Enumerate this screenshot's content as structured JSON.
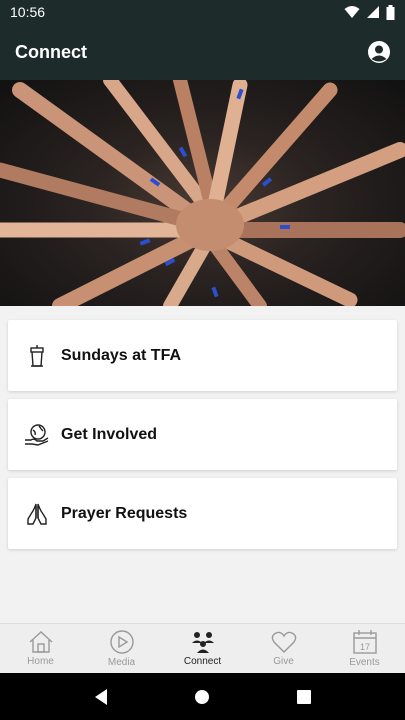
{
  "status": {
    "time": "10:56"
  },
  "app_bar": {
    "title": "Connect"
  },
  "cards": [
    {
      "label": "Sundays at TFA",
      "icon": "podium-icon"
    },
    {
      "label": "Get Involved",
      "icon": "hand-globe-icon"
    },
    {
      "label": "Prayer Requests",
      "icon": "praying-hands-icon"
    }
  ],
  "nav": [
    {
      "label": "Home",
      "icon": "home-icon",
      "active": false
    },
    {
      "label": "Media",
      "icon": "play-circle-icon",
      "active": false
    },
    {
      "label": "Connect",
      "icon": "people-icon",
      "active": true
    },
    {
      "label": "Give",
      "icon": "heart-icon",
      "active": false
    },
    {
      "label": "Events",
      "icon": "calendar-icon",
      "active": false
    }
  ],
  "events_icon_day": "17",
  "colors": {
    "app_bar_bg": "#1e2b2b",
    "nav_active": "#222222",
    "nav_inactive": "#9a9a9a"
  }
}
